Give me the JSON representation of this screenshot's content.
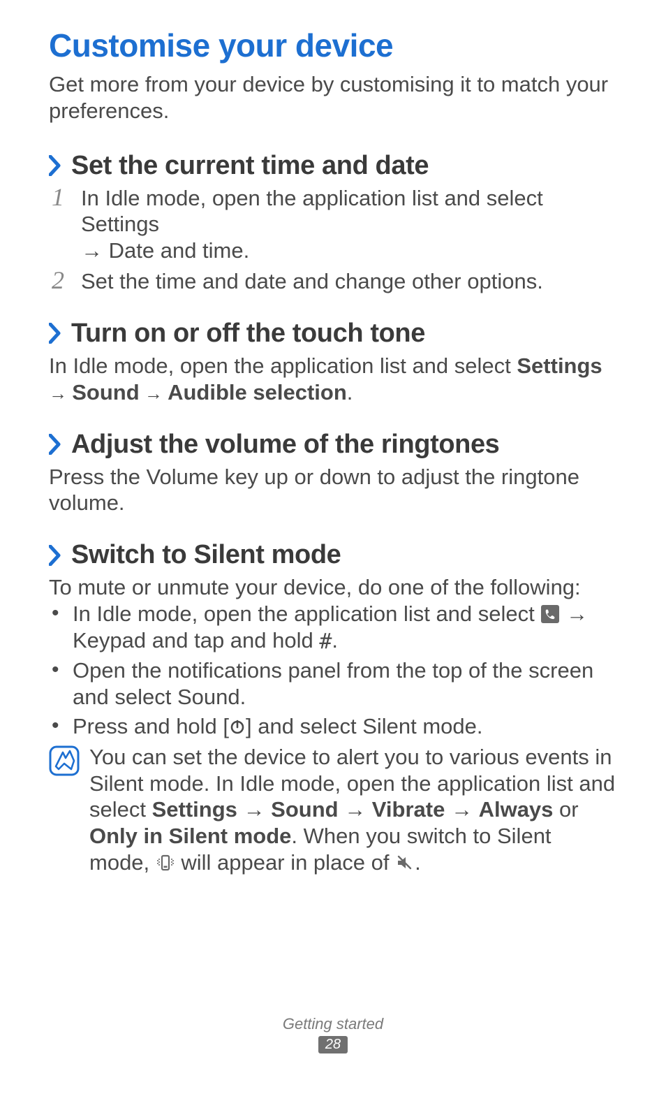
{
  "title": "Customise your device",
  "intro": "Get more from your device by customising it to match your preferences.",
  "sections": {
    "time": {
      "heading": "Set the current time and date",
      "steps": {
        "s1": {
          "num": "1",
          "pre": "In Idle mode, open the application list and select ",
          "b1": "Settings",
          "mid": " → ",
          "b2": "Date and time",
          "post": "."
        },
        "s2": {
          "num": "2",
          "text": "Set the time and date and change other options."
        }
      }
    },
    "touchtone": {
      "heading": "Turn on or off the touch tone",
      "para": {
        "pre": "In Idle mode, open the application list and select ",
        "b1": "Settings",
        "m1": " → ",
        "b2": "Sound",
        "m2": " → ",
        "b3": "Audible selection",
        "post": "."
      }
    },
    "volume": {
      "heading": "Adjust the volume of the ringtones",
      "para": "Press the Volume key up or down to adjust the ringtone volume."
    },
    "silent": {
      "heading": "Switch to Silent mode",
      "intro": "To mute or unmute your device, do one of the following:",
      "b1": {
        "pre": "In Idle mode, open the application list and select ",
        "m1": " → ",
        "bold": "Keypad",
        "mid": " and tap and hold ",
        "post": "."
      },
      "b2": {
        "pre": "Open the notifications panel from the top of the screen and select ",
        "bold": "Sound",
        "post": "."
      },
      "b3": {
        "pre": "Press and hold [",
        "mid": "] and select ",
        "bold": "Silent mode",
        "post": "."
      },
      "note": {
        "pre": "You can set the device to alert you to various events in Silent mode. In Idle mode, open the application list and select ",
        "b1": "Settings",
        "m1": " → ",
        "b2": "Sound",
        "m2": " → ",
        "b3": "Vibrate",
        "m3": " → ",
        "b4": "Always",
        "or": " or ",
        "b5": "Only in Silent mode",
        "mid": ". When you switch to Silent mode, ",
        "midpost": " will appear in place of ",
        "post": "."
      }
    }
  },
  "footer": {
    "section": "Getting started",
    "page": "28"
  }
}
